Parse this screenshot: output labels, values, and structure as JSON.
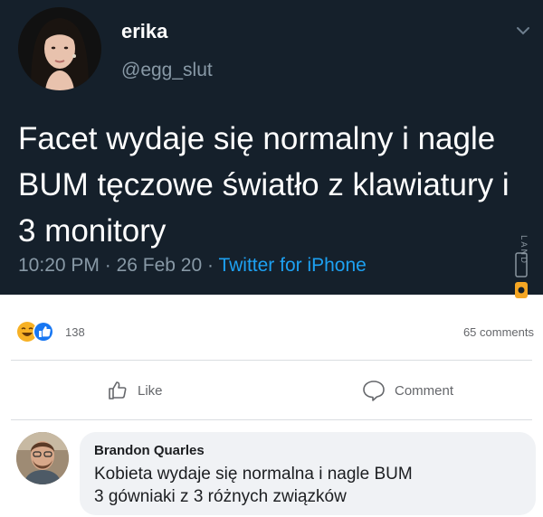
{
  "tweet": {
    "author_name": "erika",
    "author_handle": "@egg_slut",
    "text": "Facet wydaje się normalny i nagle BUM tęczowe światło z klawiatury i 3 monitory",
    "time": "10:20 PM",
    "date": "26 Feb 20",
    "source": "Twitter for iPhone",
    "separator": " · "
  },
  "watermark": {
    "text": "LAND"
  },
  "post_footer": {
    "reaction_count": "138",
    "comments_count": "65 comments",
    "like_label": "Like",
    "comment_label": "Comment"
  },
  "comment": {
    "author": "Brandon Quarles",
    "text_line1": "Kobieta wydaje się normalna i nagle BUM",
    "text_line2": "3 gówniaki z 3 różnych związków"
  },
  "colors": {
    "tweet_bg": "#15202b",
    "tweet_secondary": "#8899a6",
    "link_blue": "#1da1f2",
    "fb_like_blue": "#1877f2",
    "fb_haha_yellow": "#f7b125",
    "comment_bubble": "#f0f2f5"
  }
}
